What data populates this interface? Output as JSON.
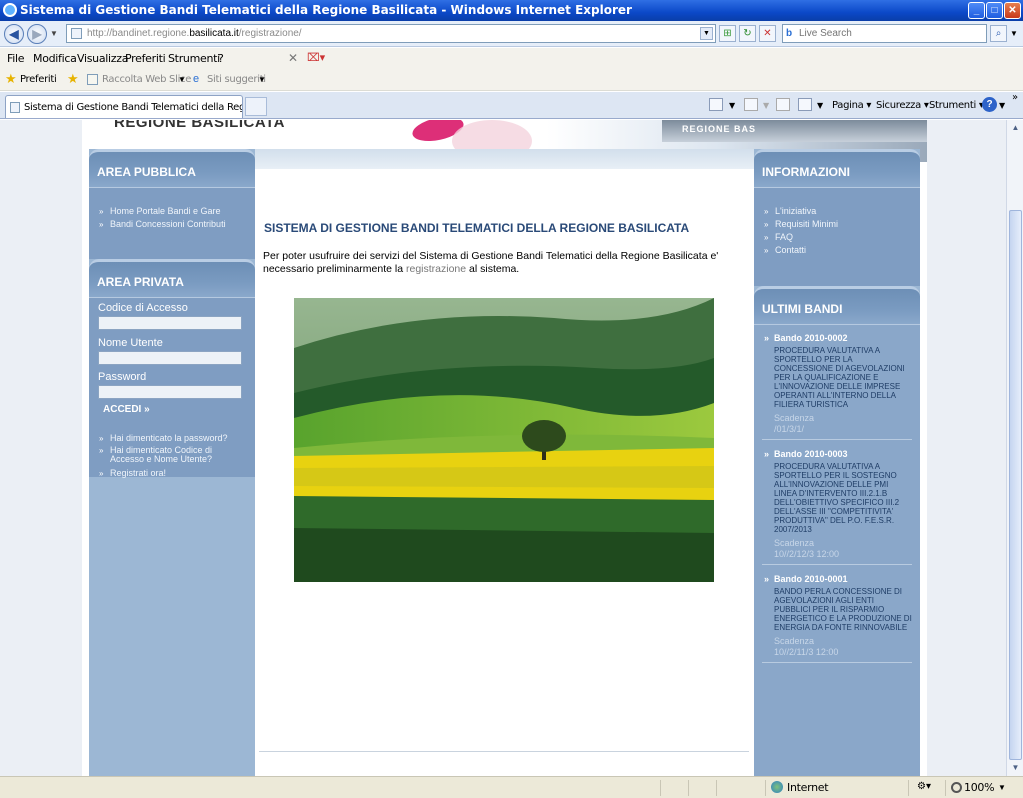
{
  "window": {
    "title": "Sistema di Gestione Bandi Telematici della Regione Basilicata - Windows Internet Explorer",
    "minimize": "_",
    "maximize": "□",
    "close": "✕"
  },
  "address": {
    "url_prefix": "http://bandinet.regione.",
    "url_domain": "basilicata.it",
    "url_path": "/registrazione/",
    "search_placeholder": "Live Search"
  },
  "menu": [
    "File",
    "Modifica",
    "Visualizza",
    "Preferiti",
    "Strumenti",
    "?"
  ],
  "favorites": {
    "preferiti": "Preferiti",
    "web_slice": "Raccolta Web Slice",
    "siti": "Siti suggeriti"
  },
  "tab": {
    "label": "Sistema di Gestione Bandi Telematici della Regione Bas..."
  },
  "commands": {
    "pagina": "Pagina",
    "sicurezza": "Sicurezza",
    "strumenti": "Strumenti",
    "help": "?"
  },
  "site": {
    "name": "REGIONE BASILICATA",
    "building_sign": "REGIONE BAS"
  },
  "area_pubblica": {
    "title": "AREA PUBBLICA",
    "links": [
      "Home Portale Bandi e Gare",
      "Bandi Concessioni Contributi"
    ]
  },
  "area_privata": {
    "title": "AREA PRIVATA",
    "codice_label": "Codice di Accesso",
    "utente_label": "Nome Utente",
    "password_label": "Password",
    "login": "ACCEDI »",
    "links": [
      "Hai dimenticato la password?",
      "Hai dimenticato Codice di Accesso e Nome Utente?",
      "Registrati ora!"
    ]
  },
  "main": {
    "title": "SISTEMA DI GESTIONE BANDI TELEMATICI DELLA REGIONE BASILICATA",
    "intro_before": "Per poter usufruire dei servizi del Sistema di Gestione Bandi Telematici della Regione Basilicata e' necessario preliminarmente la ",
    "intro_link": "registrazione",
    "intro_after": " al sistema."
  },
  "informazioni": {
    "title": "INFORMAZIONI",
    "links": [
      "L'iniziativa",
      "Requisiti Minimi",
      "FAQ",
      "Contatti"
    ]
  },
  "ultimi_bandi": {
    "title": "ULTIMI BANDI",
    "scadenza_label": "Scadenza",
    "items": [
      {
        "code": "Bando 2010-0002",
        "desc": "PROCEDURA VALUTATIVA A SPORTELLO PER LA CONCESSIONE DI AGEVOLAZIONI PER LA QUALIFICAZIONE E L'INNOVAZIONE DELLE IMPRESE OPERANTI ALL'INTERNO DELLA FILIERA TURISTICA",
        "deadline": "/01/3/1/"
      },
      {
        "code": "Bando 2010-0003",
        "desc": "PROCEDURA VALUTATIVA A SPORTELLO PER IL SOSTEGNO ALL'INNOVAZIONE DELLE PMI LINEA D'INTERVENTO III.2.1.B DELL'OBIETTIVO SPECIFICO III.2 DELL'ASSE III \"COMPETITIVITA' PRODUTTIVA\" DEL P.O. F.E.S.R. 2007/2013",
        "deadline": "10//2/12/3 12:00"
      },
      {
        "code": "Bando 2010-0001",
        "desc": "BANDO PERLA CONCESSIONE DI AGEVOLAZIONI AGLI ENTI PUBBLICI PER IL RISPARMIO ENERGETICO E LA PRODUZIONE DI ENERGIA DA FONTE RINNOVABILE",
        "deadline": "10//2/11/3 12:00"
      }
    ]
  },
  "status": {
    "zone": "Internet",
    "zoom": "100%"
  }
}
